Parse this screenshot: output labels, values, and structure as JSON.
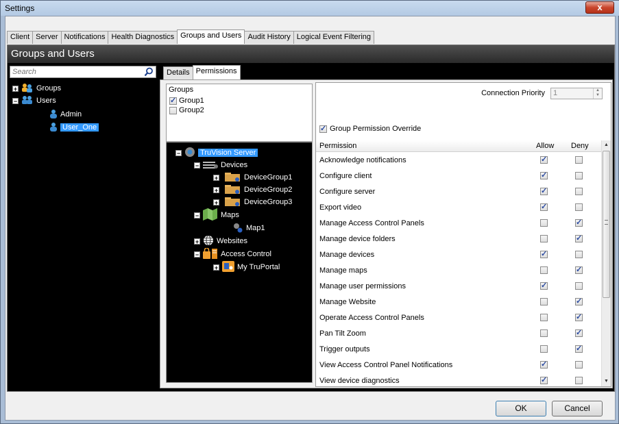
{
  "window": {
    "title": "Settings",
    "close_label": "x"
  },
  "tabs": [
    "Client",
    "Server",
    "Notifications",
    "Health Diagnostics",
    "Groups and Users",
    "Audit History",
    "Logical Event Filtering"
  ],
  "active_tab": "Groups and Users",
  "section": {
    "title": "Groups and Users"
  },
  "search": {
    "placeholder": "Search"
  },
  "left_tree": {
    "groups_label": "Groups",
    "users_label": "Users",
    "users": [
      "Admin",
      "User_One"
    ],
    "selected": "User_One"
  },
  "inner_tabs": [
    "Details",
    "Permissions"
  ],
  "groups_box": {
    "title": "Groups",
    "items": [
      {
        "label": "Group1",
        "checked": true
      },
      {
        "label": "Group2",
        "checked": false
      }
    ]
  },
  "device_tree": {
    "server": "TruVision Server",
    "devices": "Devices",
    "device_groups": [
      "DeviceGroup1",
      "DeviceGroup2",
      "DeviceGroup3"
    ],
    "maps": "Maps",
    "map_item": "Map1",
    "websites": "Websites",
    "access_control": "Access Control",
    "truportal": "My TruPortal"
  },
  "connection": {
    "label": "Connection Priority",
    "value": "1"
  },
  "override": {
    "label": "Group Permission Override",
    "checked": true
  },
  "permissions": {
    "headers": {
      "permission": "Permission",
      "allow": "Allow",
      "deny": "Deny"
    },
    "rows": [
      {
        "name": "Acknowledge notifications",
        "allow": true,
        "deny": false
      },
      {
        "name": "Configure client",
        "allow": true,
        "deny": false
      },
      {
        "name": "Configure server",
        "allow": true,
        "deny": false
      },
      {
        "name": "Export video",
        "allow": true,
        "deny": false
      },
      {
        "name": "Manage Access Control Panels",
        "allow": false,
        "deny": true
      },
      {
        "name": "Manage device folders",
        "allow": false,
        "deny": true
      },
      {
        "name": "Manage devices",
        "allow": true,
        "deny": false
      },
      {
        "name": "Manage maps",
        "allow": false,
        "deny": true
      },
      {
        "name": "Manage user permissions",
        "allow": true,
        "deny": false
      },
      {
        "name": "Manage Website",
        "allow": false,
        "deny": true
      },
      {
        "name": "Operate Access Control Panels",
        "allow": false,
        "deny": true
      },
      {
        "name": "Pan Tilt Zoom",
        "allow": false,
        "deny": true
      },
      {
        "name": "Trigger outputs",
        "allow": false,
        "deny": true
      },
      {
        "name": "View Access Control Panel Notifications",
        "allow": true,
        "deny": false
      },
      {
        "name": "View device diagnostics",
        "allow": true,
        "deny": false
      }
    ]
  },
  "footer": {
    "ok": "OK",
    "cancel": "Cancel"
  },
  "colors": {
    "selection": "#3399ff",
    "dark_bg": "#000000",
    "header_bg": "#2a2a2a"
  }
}
